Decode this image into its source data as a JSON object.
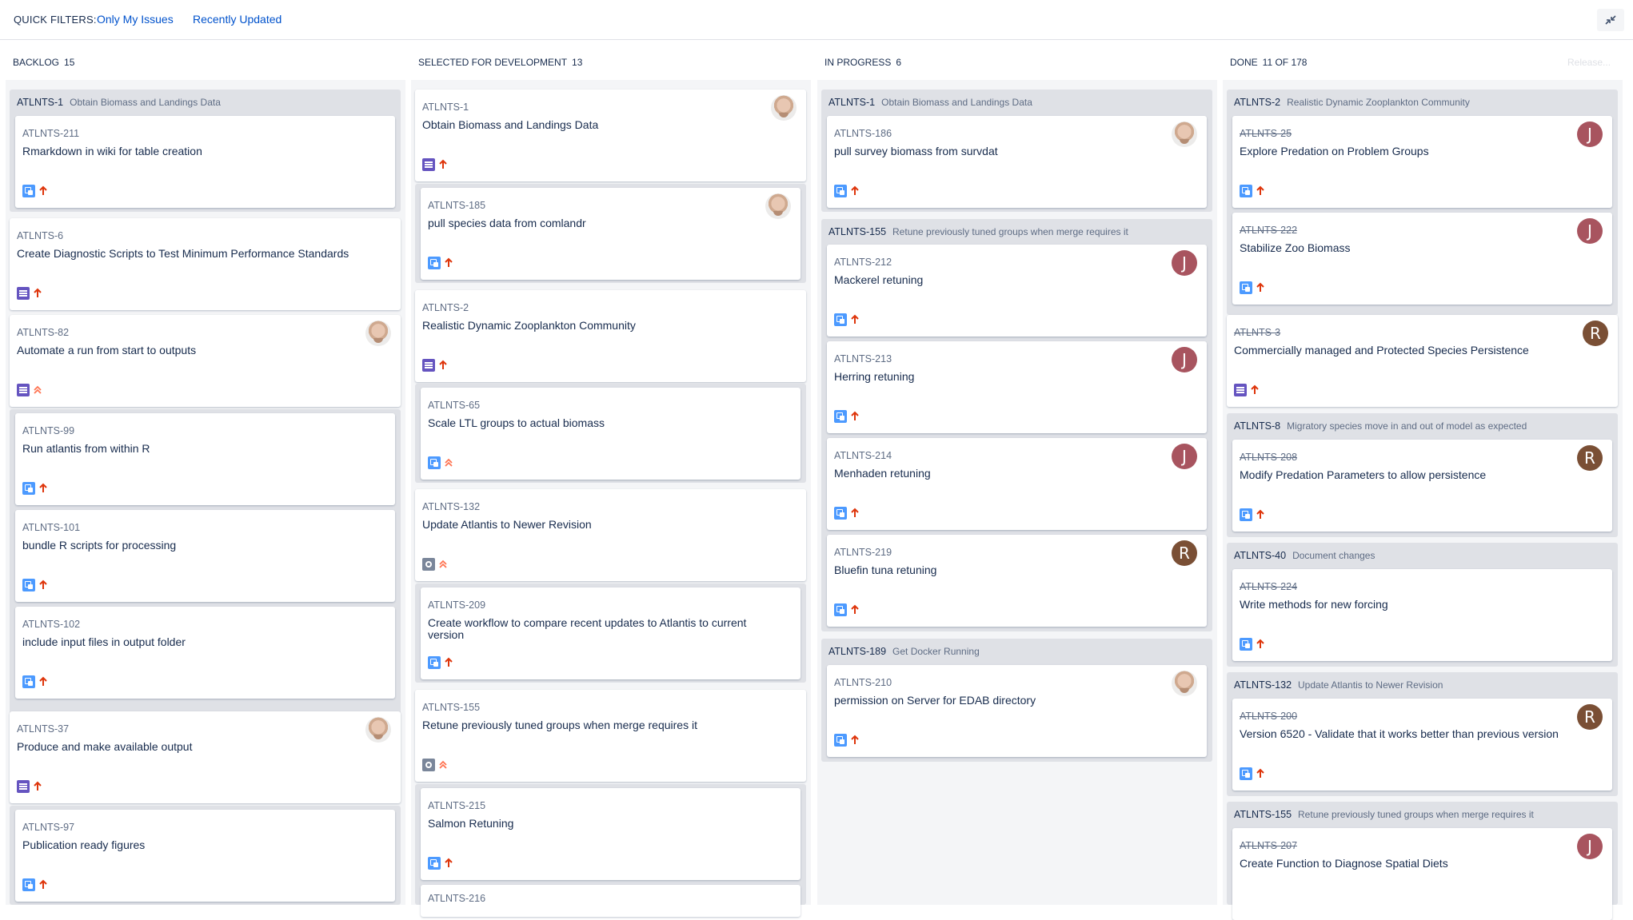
{
  "quick_filters": {
    "label": "QUICK FILTERS:",
    "items": [
      "Only My Issues",
      "Recently Updated"
    ]
  },
  "colors": {
    "avatar_j": "#a8545f",
    "avatar_r": "#7a4f35",
    "link": "#0052cc",
    "priority_high": "#de350b",
    "priority_highest": "#ff7452"
  },
  "columns": [
    {
      "name": "BACKLOG",
      "count": "15"
    },
    {
      "name": "SELECTED FOR DEVELOPMENT",
      "count": "13"
    },
    {
      "name": "IN PROGRESS",
      "count": "6"
    },
    {
      "name": "DONE",
      "count": "11 OF 178"
    }
  ],
  "release_label": "Release...",
  "backlog": {
    "group1": {
      "key": "ATLNTS-1",
      "summary": "Obtain Biomass and Landings Data"
    },
    "cards": [
      {
        "key": "ATLNTS-211",
        "summary": "Rmarkdown in wiki for table creation",
        "type": "subtask-icon",
        "priority": "high-priority-icon"
      },
      {
        "key": "ATLNTS-6",
        "summary": "Create Diagnostic Scripts to Test Minimum Performance Standards",
        "type": "story-icon",
        "priority": "high-priority-icon"
      },
      {
        "key": "ATLNTS-82",
        "summary": "Automate a run from start to outputs",
        "type": "story-icon",
        "priority": "highest-priority-icon"
      },
      {
        "key": "ATLNTS-99",
        "summary": "Run atlantis from within R",
        "type": "subtask-icon",
        "priority": "high-priority-icon"
      },
      {
        "key": "ATLNTS-101",
        "summary": "bundle R scripts for processing",
        "type": "subtask-icon",
        "priority": "high-priority-icon"
      },
      {
        "key": "ATLNTS-102",
        "summary": "include input files in output folder",
        "type": "subtask-icon",
        "priority": "high-priority-icon"
      },
      {
        "key": "ATLNTS-37",
        "summary": "Produce and make available output",
        "type": "story-icon",
        "priority": "high-priority-icon"
      },
      {
        "key": "ATLNTS-97",
        "summary": "Publication ready figures",
        "type": "subtask-icon",
        "priority": "high-priority-icon"
      }
    ]
  },
  "selected": {
    "cards": [
      {
        "key": "ATLNTS-1",
        "summary": "Obtain Biomass and Landings Data"
      },
      {
        "key": "ATLNTS-185",
        "summary": "pull species data from comlandr"
      },
      {
        "key": "ATLNTS-2",
        "summary": "Realistic Dynamic Zooplankton Community"
      },
      {
        "key": "ATLNTS-65",
        "summary": "Scale LTL groups to actual biomass"
      },
      {
        "key": "ATLNTS-132",
        "summary": "Update Atlantis to Newer Revision"
      },
      {
        "key": "ATLNTS-209",
        "summary": "Create workflow to compare recent updates to Atlantis to current version"
      },
      {
        "key": "ATLNTS-155",
        "summary": "Retune previously tuned groups when merge requires it"
      },
      {
        "key": "ATLNTS-215",
        "summary": "Salmon Retuning"
      },
      {
        "key": "ATLNTS-216",
        "summary": ""
      }
    ]
  },
  "in_progress": {
    "groups": [
      {
        "key": "ATLNTS-1",
        "summary": "Obtain Biomass and Landings Data"
      },
      {
        "key": "ATLNTS-155",
        "summary": "Retune previously tuned groups when merge requires it"
      },
      {
        "key": "ATLNTS-189",
        "summary": "Get Docker Running"
      }
    ],
    "cards": [
      {
        "key": "ATLNTS-186",
        "summary": "pull survey biomass from survdat"
      },
      {
        "key": "ATLNTS-212",
        "summary": "Mackerel retuning",
        "avatar": "J"
      },
      {
        "key": "ATLNTS-213",
        "summary": "Herring retuning",
        "avatar": "J"
      },
      {
        "key": "ATLNTS-214",
        "summary": "Menhaden retuning",
        "avatar": "J"
      },
      {
        "key": "ATLNTS-219",
        "summary": "Bluefin tuna retuning",
        "avatar": "R"
      },
      {
        "key": "ATLNTS-210",
        "summary": "permission on Server for EDAB directory"
      }
    ]
  },
  "done": {
    "groups": [
      {
        "key": "ATLNTS-2",
        "summary": "Realistic Dynamic Zooplankton Community"
      },
      {
        "key": "ATLNTS-8",
        "summary": "Migratory species move in and out of model as expected"
      },
      {
        "key": "ATLNTS-40",
        "summary": "Document changes"
      },
      {
        "key": "ATLNTS-132",
        "summary": "Update Atlantis to Newer Revision"
      },
      {
        "key": "ATLNTS-155",
        "summary": "Retune previously tuned groups when merge requires it"
      }
    ],
    "cards": [
      {
        "key": "ATLNTS-25",
        "summary": "Explore Predation on Problem Groups",
        "avatar": "J"
      },
      {
        "key": "ATLNTS-222",
        "summary": "Stabilize Zoo Biomass",
        "avatar": "J"
      },
      {
        "key": "ATLNTS-3",
        "summary": "Commercially managed and Protected Species Persistence",
        "avatar": "R"
      },
      {
        "key": "ATLNTS-208",
        "summary": "Modify Predation Parameters to allow persistence",
        "avatar": "R"
      },
      {
        "key": "ATLNTS-224",
        "summary": "Write methods for new forcing"
      },
      {
        "key": "ATLNTS-200",
        "summary": "Version 6520 - Validate that it works better than previous version",
        "avatar": "R"
      },
      {
        "key": "ATLNTS-207",
        "summary": "Create Function to Diagnose Spatial Diets",
        "avatar": "J"
      }
    ]
  }
}
